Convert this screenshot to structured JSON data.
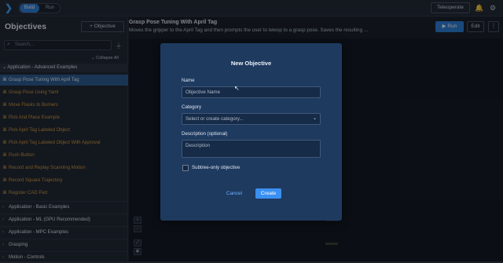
{
  "topbar": {
    "logo_icon": "chevron-logo-icon",
    "mode_build": "Build",
    "mode_run": "Run",
    "teleoperate_label": "Teleoperate",
    "bell_icon": "🔔",
    "gear_icon": "⚙"
  },
  "sidebar": {
    "title": "Objectives",
    "add_objective_label": "+ Objective",
    "search_placeholder": "Search...",
    "collapse_all_label": "⌄ Collapse All",
    "open_group": "Application - Advanced Examples",
    "items": [
      {
        "label": "Grasp Pose Tuning With April Tag",
        "selected": true
      },
      {
        "label": "Grasp Pose Using Yaml",
        "selected": false
      },
      {
        "label": "Move Flasks to Burners",
        "selected": false
      },
      {
        "label": "Pick And Place Example",
        "selected": false
      },
      {
        "label": "Pick April Tag Labeled Object",
        "selected": false
      },
      {
        "label": "Pick April Tag Labeled Object With Approval",
        "selected": false
      },
      {
        "label": "Push Button",
        "selected": false
      },
      {
        "label": "Record and Replay Scanning Motion",
        "selected": false
      },
      {
        "label": "Record Square Trajectory",
        "selected": false
      },
      {
        "label": "Register CAD Part",
        "selected": false
      }
    ],
    "categories": [
      "Application - Basic Examples",
      "Application - ML (GPU Recommended)",
      "Application - MPC Examples",
      "Grasping",
      "Motion - Controls"
    ]
  },
  "content": {
    "objective_title": "Grasp Pose Tuning With April Tag",
    "objective_description": "Moves the gripper to the April Tag and then prompts the user to teleop to a grasp pose. Saves the resulting ...",
    "run_label": "▶ Run",
    "edit_label": "Edit",
    "more_label": "⋮"
  },
  "modal": {
    "title": "New Objective",
    "name_label": "Name",
    "name_placeholder": "Objective Name",
    "category_label": "Category",
    "category_placeholder": "Select or create category...",
    "description_label": "Description (optional)",
    "description_placeholder": "Description",
    "subtree_label": "Subtree-only objective",
    "subtree_checked": false,
    "cancel_label": "Cancel",
    "create_label": "Create"
  },
  "colors": {
    "accent": "#2d7fd8",
    "item_orange": "#d79a3e",
    "modal_bg": "#1e3a5f"
  }
}
